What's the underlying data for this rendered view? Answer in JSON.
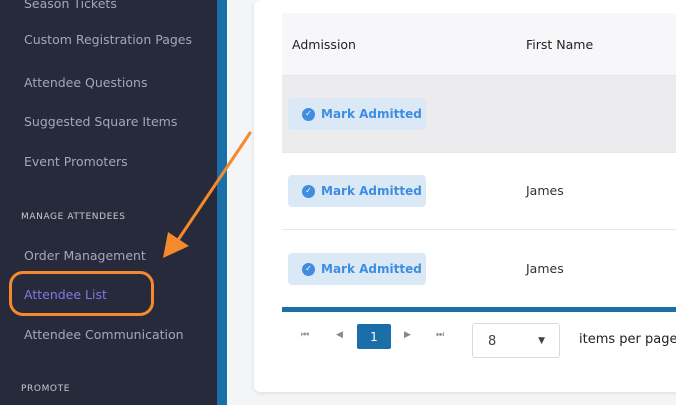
{
  "sidebar": {
    "items_top": [
      {
        "label": "Season Tickets"
      },
      {
        "label": "Custom Registration Pages"
      },
      {
        "label": "Attendee Questions"
      },
      {
        "label": "Suggested Square Items"
      },
      {
        "label": "Event Promoters"
      }
    ],
    "section_manage": "MANAGE ATTENDEES",
    "manage_items": [
      {
        "label": "Order Management"
      },
      {
        "label": "Attendee List"
      },
      {
        "label": "Attendee Communication"
      }
    ],
    "section_promote": "PROMOTE"
  },
  "table": {
    "columns": [
      "Admission",
      "First Name"
    ],
    "rows": [
      {
        "admission_label": "Mark Admitted",
        "first_name": ""
      },
      {
        "admission_label": "Mark Admitted",
        "first_name": "James"
      },
      {
        "admission_label": "Mark Admitted",
        "first_name": "James"
      }
    ]
  },
  "pagination": {
    "current_page": "1",
    "first_icon": "⏮",
    "prev_icon": "◀",
    "next_icon": "▶",
    "last_icon": "⏭",
    "per_page_value": "8",
    "per_page_caret": "▼",
    "items_per_page_label": "items per page"
  },
  "colors": {
    "sidebar_bg": "#272a3a",
    "accent_blue": "#1b6fa8",
    "active_nav": "#7f78e6",
    "annotation_orange": "#f5892e",
    "admit_button_bg": "#dbe8f5",
    "admit_button_text": "#3f8de0"
  }
}
